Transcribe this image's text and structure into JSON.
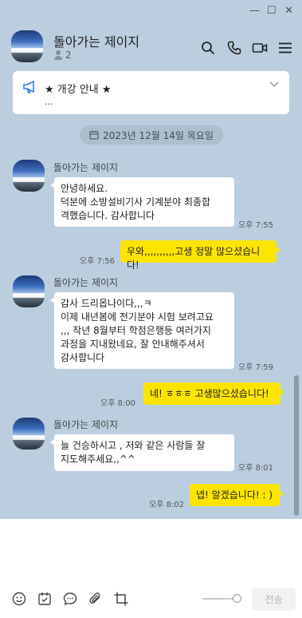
{
  "window": {
    "minimize_icon": "minimize-icon",
    "maximize_icon": "maximize-icon",
    "close_icon": "close-icon"
  },
  "header": {
    "title": "돌아가는 제이지",
    "member_count": "2",
    "icons": [
      "search-icon",
      "phone-icon",
      "video-call-icon",
      "menu-icon"
    ]
  },
  "notice": {
    "title": "★ 개강 안내 ★",
    "subtitle": "..."
  },
  "date_divider": "2023년 12월 14일 목요일",
  "messages": [
    {
      "direction": "in",
      "sender": "돌아가는 제이지",
      "text": "안녕하세요.\n덕분에 소방설비기사 기계분야 최종합\n격했습니다. 감사합니다",
      "time": "오후 7:55"
    },
    {
      "direction": "out",
      "text": "우와,,,,,,,,,,고생 정말 많으셨습니다!",
      "time": "오후 7:56"
    },
    {
      "direction": "in",
      "sender": "돌아가는 제이지",
      "text": "감사 드리옵나이다,,,ㅋ\n이제 내년봄에 전기분야 시험 보려고요\n,,, 작년 8월부터 학점은행등 여러가지\n과정을 지내왔네요, 잘 안내해주셔서\n감사합니다",
      "time": "오후 7:59"
    },
    {
      "direction": "out",
      "text": "네! ㅎㅎㅎ 고생많으셨습니다!",
      "time": "오후 8:00"
    },
    {
      "direction": "in",
      "sender": "돌아가는 제이지",
      "text": "늘 건승하시고 , 저와 같은 사람들 잘\n지도해주세요,,^^",
      "time": "오후 8:01"
    },
    {
      "direction": "out",
      "text": "넵! 알겠습니다! : )",
      "time": "오후 8:02"
    }
  ],
  "input": {
    "value": "",
    "placeholder": "",
    "send_label": "전송"
  },
  "toolbar": {
    "icons": [
      "emoji-icon",
      "calendar-icon",
      "chat-bubble-icon",
      "attachment-icon",
      "crop-icon"
    ]
  },
  "colors": {
    "background": "#bacee0",
    "outgoing_bubble": "#fee500",
    "incoming_bubble": "#ffffff"
  }
}
